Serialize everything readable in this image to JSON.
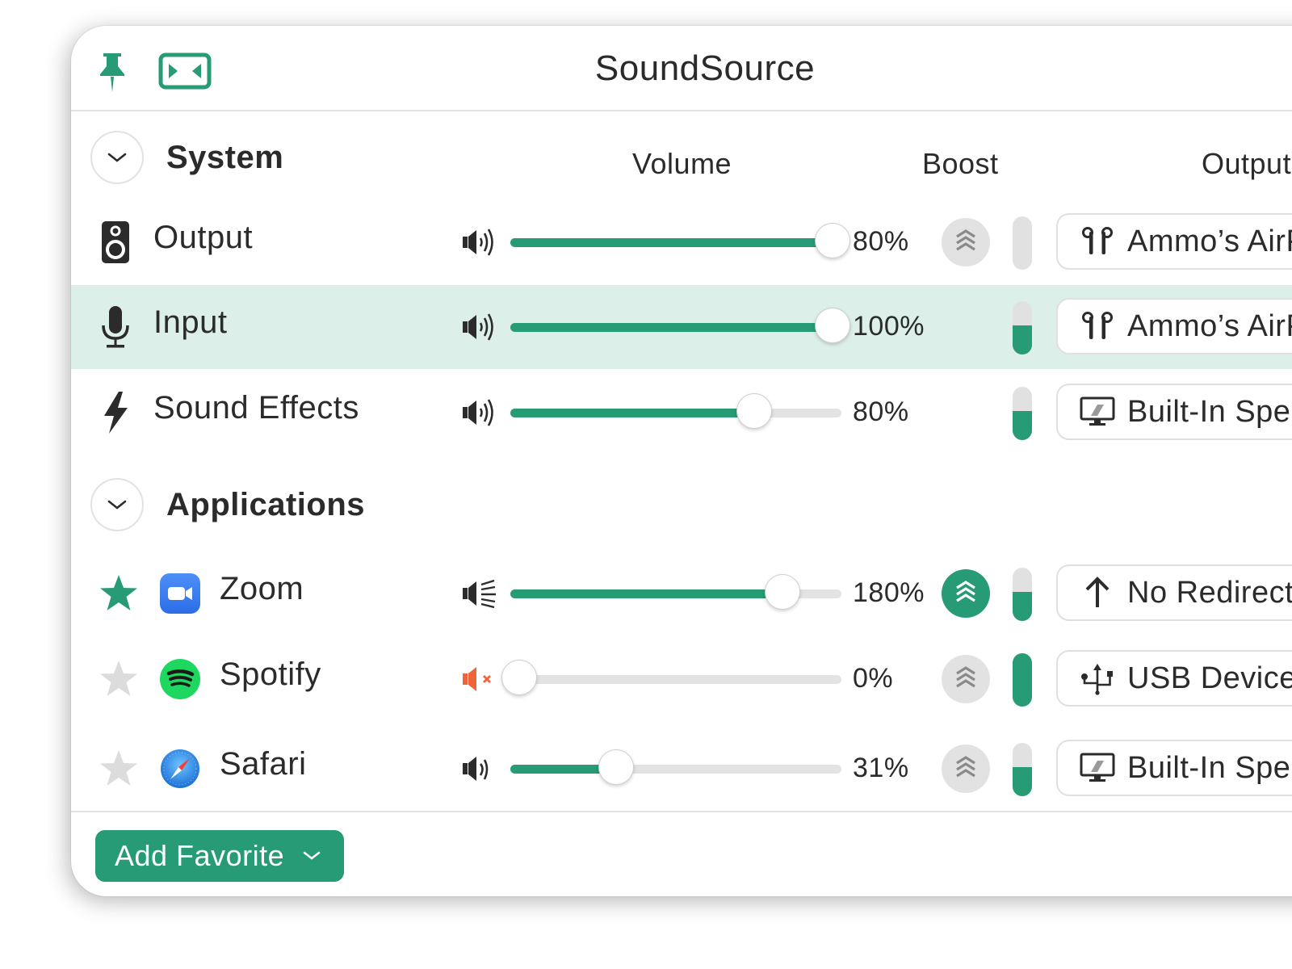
{
  "window": {
    "title": "SoundSource",
    "pin_icon": "pushpin-icon",
    "fit_icon": "collapse-window-icon"
  },
  "columns": {
    "volume": "Volume",
    "boost": "Boost",
    "output": "Output"
  },
  "system": {
    "title": "System",
    "expanded": true,
    "rows": [
      {
        "label": "Output",
        "icon": "speaker-icon",
        "volume_percent": 80,
        "slider_fraction": 1.0,
        "volume_text": "80%",
        "volume_icon": "volume-high-icon",
        "boost": false,
        "boost_visible": true,
        "meter_level": 0.0,
        "device": "Ammo’s AirPods",
        "device_icon": "airpods-icon",
        "selected": false
      },
      {
        "label": "Input",
        "icon": "microphone-icon",
        "volume_percent": 100,
        "slider_fraction": 1.0,
        "volume_text": "100%",
        "volume_icon": "volume-high-icon",
        "boost": false,
        "boost_visible": false,
        "meter_level": 0.55,
        "device": "Ammo’s AirPods",
        "device_icon": "airpods-icon",
        "selected": true
      },
      {
        "label": "Sound Effects",
        "icon": "lightning-icon",
        "volume_percent": 80,
        "slider_fraction": 0.75,
        "volume_text": "80%",
        "volume_icon": "volume-high-icon",
        "boost": false,
        "boost_visible": false,
        "meter_level": 0.55,
        "device": "Built-In Speakers",
        "device_icon": "imac-icon",
        "selected": false
      }
    ]
  },
  "applications": {
    "title": "Applications",
    "expanded": true,
    "rows": [
      {
        "label": "Zoom",
        "app_icon": "zoom-app-icon",
        "favorite": true,
        "volume_percent": 180,
        "slider_fraction": 0.84,
        "volume_text": "180%",
        "volume_icon": "volume-boosted-icon",
        "boost": true,
        "meter_level": 0.55,
        "device": "No Redirect",
        "device_icon": "arrow-up-icon"
      },
      {
        "label": "Spotify",
        "app_icon": "spotify-app-icon",
        "favorite": false,
        "volume_percent": 0,
        "slider_fraction": 0.0,
        "volume_text": "0%",
        "volume_icon": "volume-muted-icon",
        "boost": false,
        "meter_level": 1.0,
        "device": "USB Device",
        "device_icon": "usb-icon"
      },
      {
        "label": "Safari",
        "app_icon": "safari-app-icon",
        "favorite": false,
        "volume_percent": 31,
        "slider_fraction": 0.31,
        "volume_text": "31%",
        "volume_icon": "volume-low-icon",
        "boost": false,
        "meter_level": 0.55,
        "device": "Built-In Speakers",
        "device_icon": "imac-icon"
      }
    ]
  },
  "footer": {
    "add_favorite_label": "Add Favorite"
  },
  "colors": {
    "accent": "#279a76",
    "selected_row": "#dcefe9",
    "muted": "#f0643c",
    "inactive": "#e1e1e1"
  }
}
